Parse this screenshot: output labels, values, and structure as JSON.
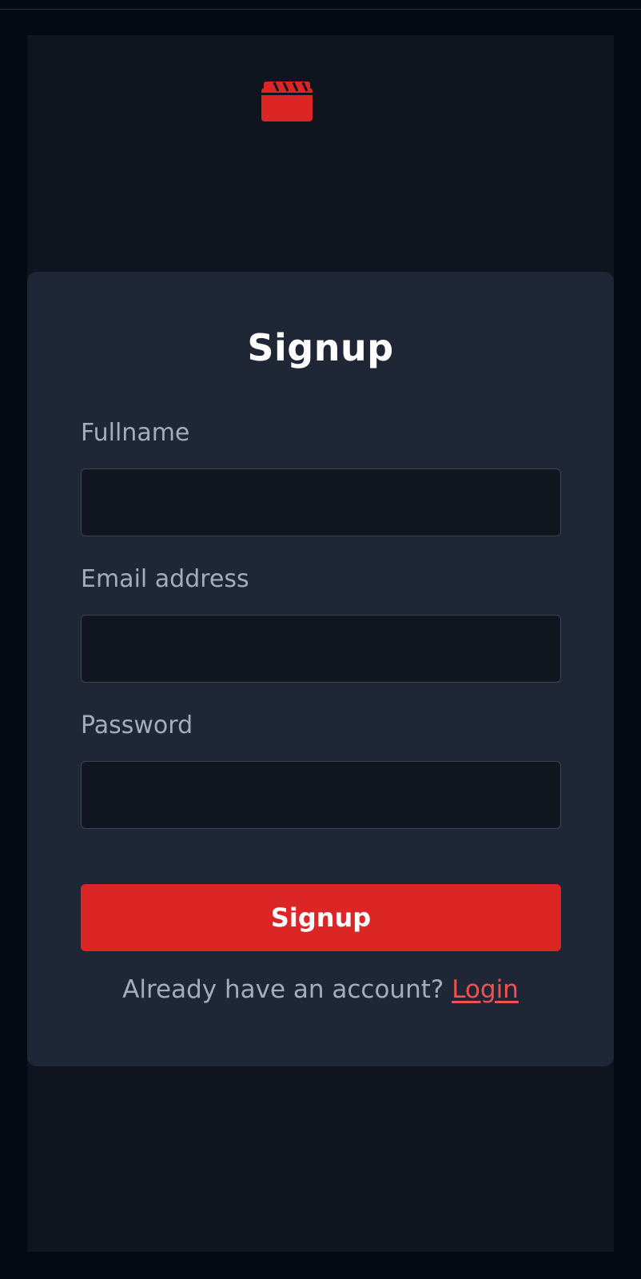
{
  "brand": {
    "logo_icon": "clapperboard-icon",
    "accent_color": "#dc2626"
  },
  "signup_form": {
    "title": "Signup",
    "fields": [
      {
        "label": "Fullname",
        "value": "",
        "placeholder": ""
      },
      {
        "label": "Email address",
        "value": "",
        "placeholder": ""
      },
      {
        "label": "Password",
        "value": "",
        "placeholder": ""
      }
    ],
    "submit_label": "Signup",
    "footer_prompt": "Already have an account?",
    "login_link_label": "Login"
  },
  "colors": {
    "page_background": "#050912",
    "app_background": "#10141f",
    "card_background": "#1f2636",
    "input_background": "#111620",
    "label_text": "#a4adbb",
    "link": "#f05252"
  }
}
